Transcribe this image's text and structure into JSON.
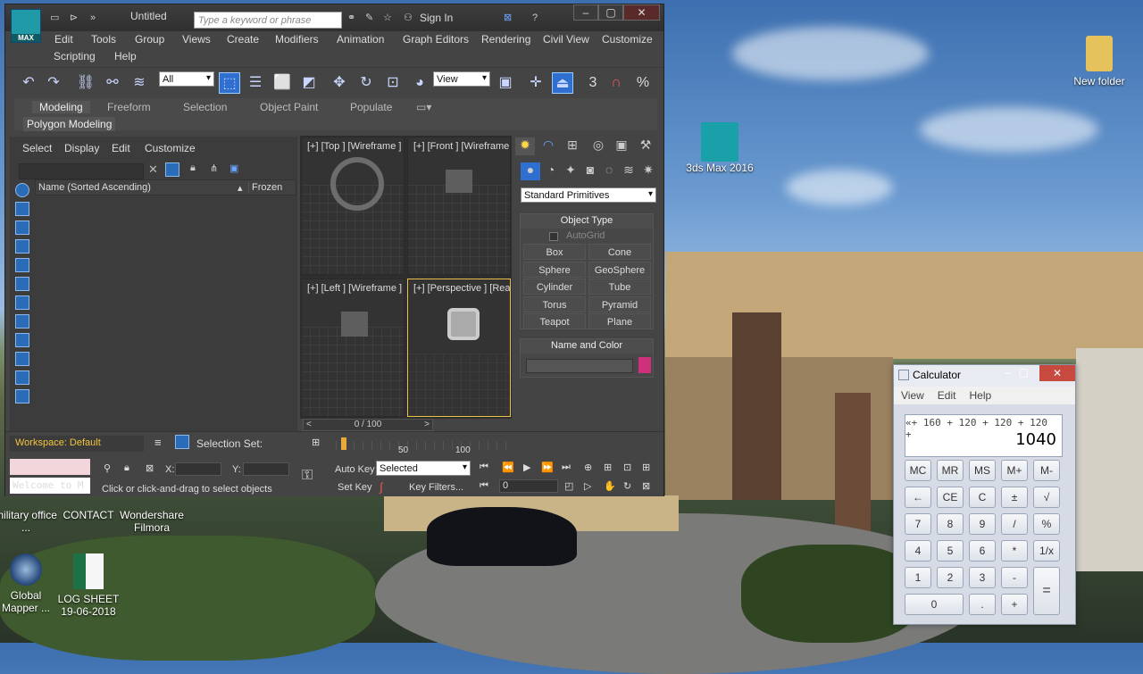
{
  "desktop": {
    "icons": [
      {
        "label": "New folder"
      },
      {
        "label": "3ds Max 2016"
      },
      {
        "label": "military office ..."
      },
      {
        "label": "CONTACT"
      },
      {
        "label": "Wondershare Filmora"
      },
      {
        "label": "Global Mapper ..."
      },
      {
        "label": "LOG SHEET 19-06-2018"
      }
    ]
  },
  "max": {
    "logo_text": "MAX",
    "title": "Untitled",
    "search_placeholder": "Type a keyword or phrase",
    "sign_in": "Sign In",
    "menu": [
      "Edit",
      "Tools",
      "Group",
      "Views",
      "Create",
      "Modifiers",
      "Animation",
      "Graph Editors",
      "Rendering",
      "Civil View",
      "Customize",
      "Scripting",
      "Help"
    ],
    "toolbar": {
      "selection_filter": "All",
      "reference_coord": "View",
      "snap_label": "3",
      "percent": "%"
    },
    "ribbon": {
      "tabs": [
        "Modeling",
        "Freeform",
        "Selection",
        "Object Paint",
        "Populate"
      ],
      "sub": "Polygon Modeling"
    },
    "scene_explorer": {
      "menu": [
        "Select",
        "Display",
        "Edit",
        "Customize"
      ],
      "col_name": "Name (Sorted Ascending)",
      "col_frozen": "Frozen"
    },
    "viewports": [
      {
        "label": "[+] [Top ] [Wireframe ]"
      },
      {
        "label": "[+] [Front ] [Wireframe"
      },
      {
        "label": "[+] [Left ] [Wireframe ]"
      },
      {
        "label": "[+] [Perspective ] [Rea"
      }
    ],
    "command_panel": {
      "category": "Standard Primitives",
      "object_type_title": "Object Type",
      "autogrid": "AutoGrid",
      "buttons": [
        "Box",
        "Cone",
        "Sphere",
        "GeoSphere",
        "Cylinder",
        "Tube",
        "Torus",
        "Pyramid",
        "Teapot",
        "Plane"
      ],
      "name_color_title": "Name and Color",
      "color": "#d0307a"
    },
    "time_slider": "0 / 100",
    "timeline_ticks": [
      "50",
      "100"
    ],
    "bottom": {
      "workspace": "Workspace: Default",
      "selection_set": "Selection Set:",
      "maxscript": "Welcome to M",
      "x_label": "X:",
      "y_label": "Y:",
      "status": "Click or click-and-drag to select objects",
      "auto_key": "Auto Key",
      "key_mode": "Selected",
      "set_key": "Set Key",
      "key_filters": "Key Filters...",
      "frame": "0"
    }
  },
  "calculator": {
    "title": "Calculator",
    "menu": [
      "View",
      "Edit",
      "Help"
    ],
    "expression": "«+ 160 + 120 + 120 + 120 +",
    "value": "1040",
    "keys": [
      [
        "MC",
        "MR",
        "MS",
        "M+",
        "M-"
      ],
      [
        "←",
        "CE",
        "C",
        "±",
        "√"
      ],
      [
        "7",
        "8",
        "9",
        "/",
        "%"
      ],
      [
        "4",
        "5",
        "6",
        "*",
        "1/x"
      ],
      [
        "1",
        "2",
        "3",
        "-",
        "="
      ],
      [
        "0",
        ".",
        "+"
      ]
    ]
  }
}
